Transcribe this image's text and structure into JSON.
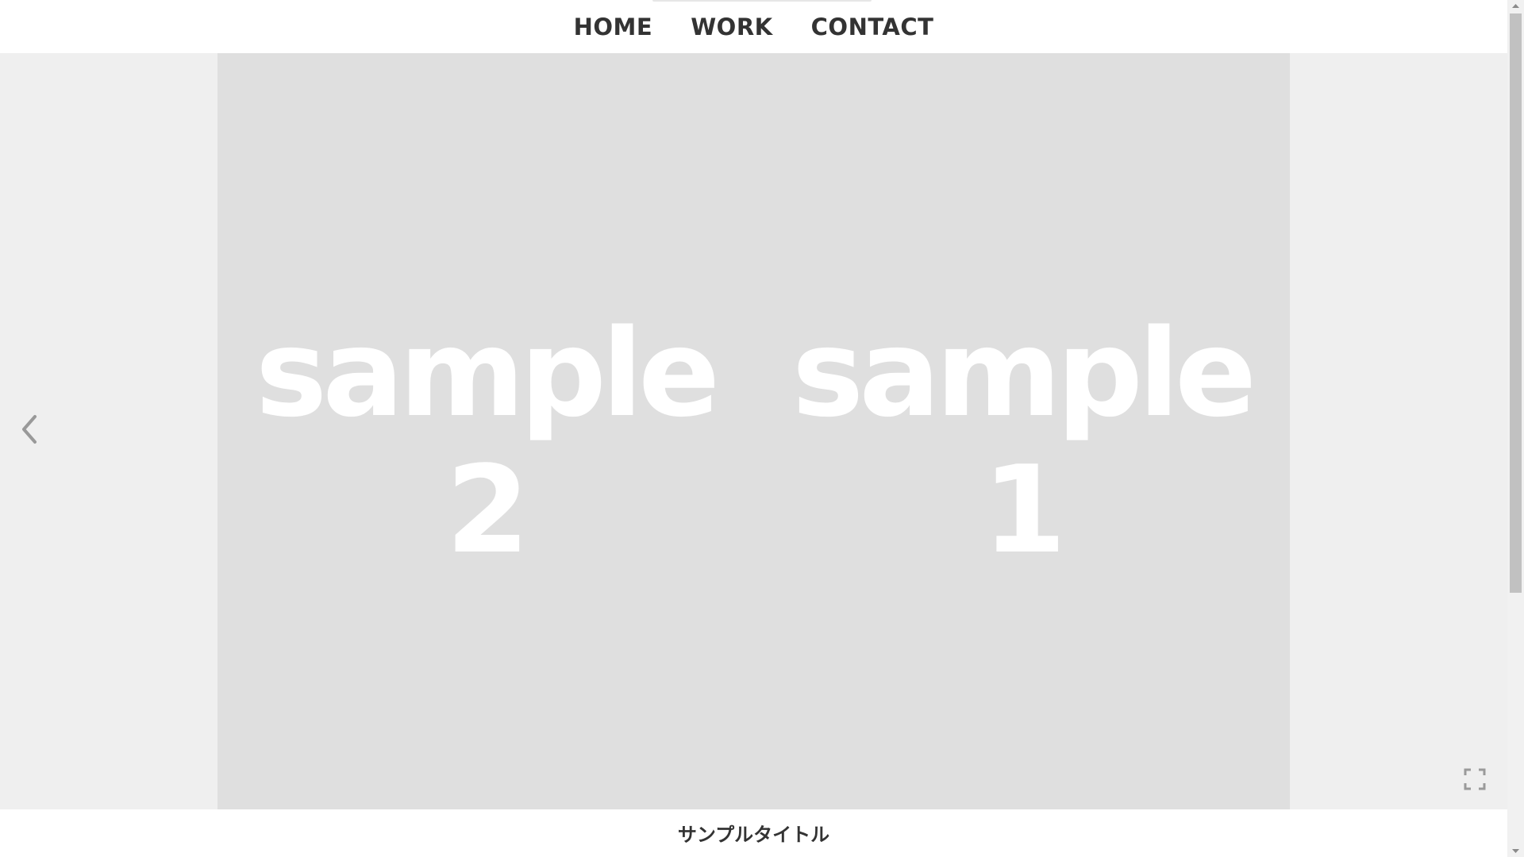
{
  "nav": {
    "items": [
      {
        "label": "HOME"
      },
      {
        "label": "WORK"
      },
      {
        "label": "CONTACT"
      }
    ]
  },
  "gallery": {
    "slides": [
      {
        "text": "sample\n2"
      },
      {
        "text": "sample\n1"
      }
    ],
    "prev_icon": "chevron-left-icon",
    "fullscreen_icon": "fullscreen-icon",
    "stage_color": "#efefef",
    "slide_color": "#dfdfdf"
  },
  "caption": {
    "title": "サンプルタイトル"
  },
  "scrollbar": {
    "up_icon": "scroll-up-icon",
    "down_icon": "scroll-down-icon"
  }
}
